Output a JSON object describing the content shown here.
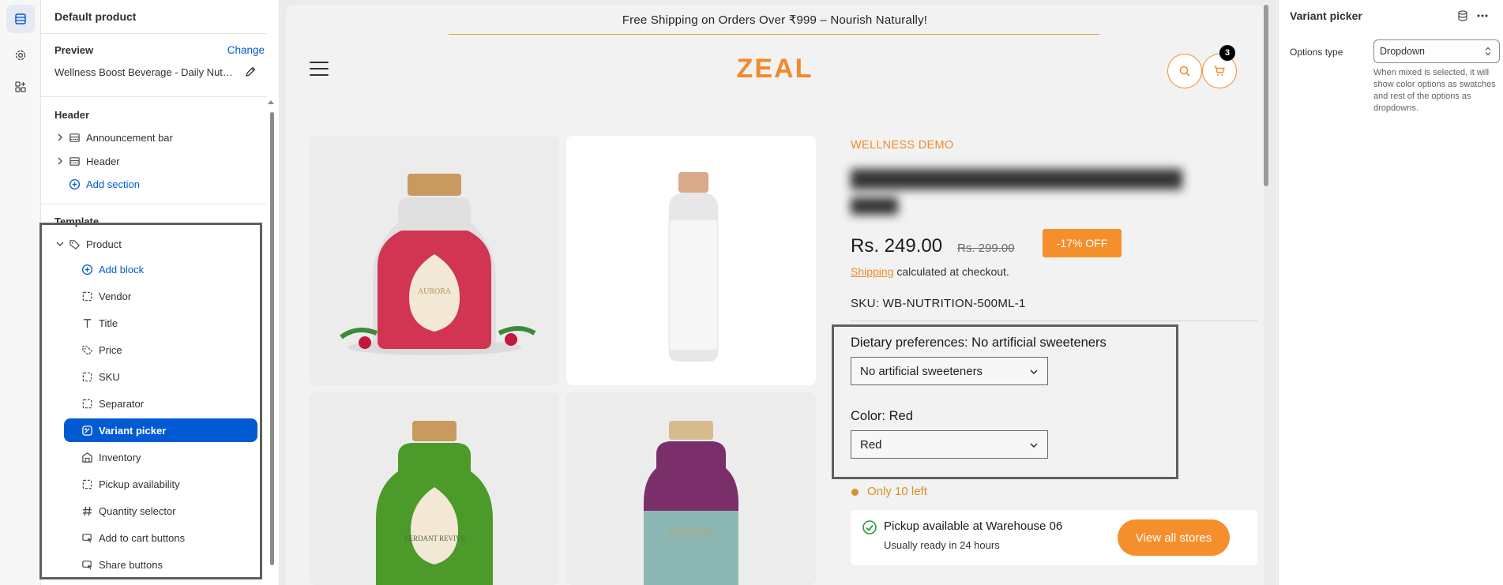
{
  "sidebar": {
    "title": "Default product",
    "preview_label": "Preview",
    "change_label": "Change",
    "preview_value": "Wellness Boost Beverage - Daily Nutrition",
    "header_group": "Header",
    "header_items": [
      {
        "label": "Announcement bar"
      },
      {
        "label": "Header"
      }
    ],
    "add_section": "Add section",
    "template_group": "Template",
    "product_label": "Product",
    "add_block": "Add block",
    "blocks": [
      {
        "label": "Vendor"
      },
      {
        "label": "Title"
      },
      {
        "label": "Price"
      },
      {
        "label": "SKU"
      },
      {
        "label": "Separator"
      },
      {
        "label": "Variant picker"
      },
      {
        "label": "Inventory"
      },
      {
        "label": "Pickup availability"
      },
      {
        "label": "Quantity selector"
      },
      {
        "label": "Add to cart buttons"
      },
      {
        "label": "Share buttons"
      }
    ]
  },
  "store": {
    "announcement": "Free Shipping on Orders Over ₹999 – Nourish Naturally!",
    "logo": "ZEAL",
    "cart_count": "3",
    "vendor": "WELLNESS DEMO",
    "price": "Rs. 249.00",
    "compare_price": "Rs. 299.00",
    "discount_badge": "-17% OFF",
    "shipping_link": "Shipping",
    "shipping_rest": " calculated at checkout.",
    "sku": "SKU: WB-NUTRITION-500ML-1",
    "option1_label": "Dietary preferences: No artificial sweeteners",
    "option1_value": "No artificial sweeteners",
    "option2_label": "Color: Red",
    "option2_value": "Red",
    "stock": "Only 10 left",
    "pickup_title": "Pickup available at Warehouse 06",
    "pickup_sub": "Usually ready in 24 hours",
    "view_stores": "View all stores",
    "bottle_labels": {
      "red": "AURORA",
      "green": "VERDANT REVIVE",
      "purple": "REPLENISH"
    }
  },
  "settings": {
    "title": "Variant picker",
    "options_type_label": "Options type",
    "options_type_value": "Dropdown",
    "help_text": "When mixed is selected, it will show color options as swatches and rest of the options as dropdowns."
  },
  "colors": {
    "accent": "#f18a2c",
    "selected": "#005bd3",
    "link": "#005bd3"
  }
}
